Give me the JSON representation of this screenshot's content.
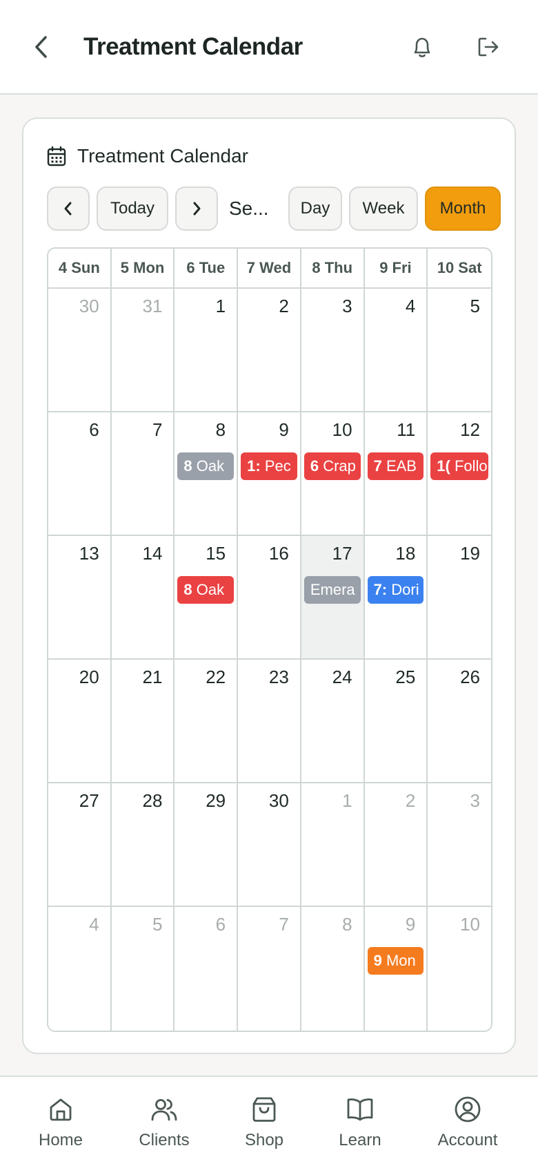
{
  "header": {
    "title": "Treatment Calendar",
    "back_icon": "chevron-left-icon",
    "bell_icon": "bell-icon",
    "logout_icon": "logout-icon"
  },
  "calendar": {
    "card_title": "Treatment Calendar",
    "card_icon": "calendar-icon",
    "today_label": "Today",
    "range_label": "Se...",
    "view_day": "Day",
    "view_week": "Week",
    "view_month": "Month",
    "active_view": "Month",
    "accent_color": "#f29d0e",
    "weekdays": [
      "4 Sun",
      "5 Mon",
      "6 Tue",
      "7 Wed",
      "8 Thu",
      "9 Fri",
      "10 Sat"
    ],
    "weeks": [
      [
        {
          "day": "30",
          "other": true
        },
        {
          "day": "31",
          "other": true
        },
        {
          "day": "1"
        },
        {
          "day": "2"
        },
        {
          "day": "3"
        },
        {
          "day": "4"
        },
        {
          "day": "5"
        }
      ],
      [
        {
          "day": "6"
        },
        {
          "day": "7"
        },
        {
          "day": "8",
          "event": {
            "time": "8",
            "title": "Oak",
            "color": "#9aa0aa"
          }
        },
        {
          "day": "9",
          "event": {
            "time": "1:",
            "title": "Pec",
            "color": "#ea4242"
          }
        },
        {
          "day": "10",
          "event": {
            "time": "6",
            "title": "Crap",
            "color": "#ea4242"
          }
        },
        {
          "day": "11",
          "event": {
            "time": "7",
            "title": "EAB",
            "color": "#ea4242"
          }
        },
        {
          "day": "12",
          "event": {
            "time": "1(",
            "title": "Follo",
            "color": "#ea4242"
          }
        }
      ],
      [
        {
          "day": "13"
        },
        {
          "day": "14"
        },
        {
          "day": "15",
          "event": {
            "time": "8",
            "title": "Oak",
            "color": "#ea4242"
          }
        },
        {
          "day": "16"
        },
        {
          "day": "17",
          "today": true,
          "event": {
            "time": "",
            "title": "Emera",
            "color": "#9aa0aa"
          }
        },
        {
          "day": "18",
          "event": {
            "time": "7:",
            "title": "Dori",
            "color": "#3b82f0"
          }
        },
        {
          "day": "19"
        }
      ],
      [
        {
          "day": "20"
        },
        {
          "day": "21"
        },
        {
          "day": "22"
        },
        {
          "day": "23"
        },
        {
          "day": "24"
        },
        {
          "day": "25"
        },
        {
          "day": "26"
        }
      ],
      [
        {
          "day": "27"
        },
        {
          "day": "28"
        },
        {
          "day": "29"
        },
        {
          "day": "30"
        },
        {
          "day": "1",
          "other": true
        },
        {
          "day": "2",
          "other": true
        },
        {
          "day": "3",
          "other": true
        }
      ],
      [
        {
          "day": "4",
          "other": true
        },
        {
          "day": "5",
          "other": true
        },
        {
          "day": "6",
          "other": true
        },
        {
          "day": "7",
          "other": true
        },
        {
          "day": "8",
          "other": true
        },
        {
          "day": "9",
          "other": true,
          "event": {
            "time": "9",
            "title": "Mon",
            "color": "#f57b1f"
          }
        },
        {
          "day": "10",
          "other": true
        }
      ]
    ]
  },
  "nav": {
    "items": [
      {
        "label": "Home",
        "icon": "home-icon"
      },
      {
        "label": "Clients",
        "icon": "users-icon"
      },
      {
        "label": "Shop",
        "icon": "shopping-bag-icon"
      },
      {
        "label": "Learn",
        "icon": "book-icon"
      },
      {
        "label": "Account",
        "icon": "account-icon"
      }
    ]
  }
}
